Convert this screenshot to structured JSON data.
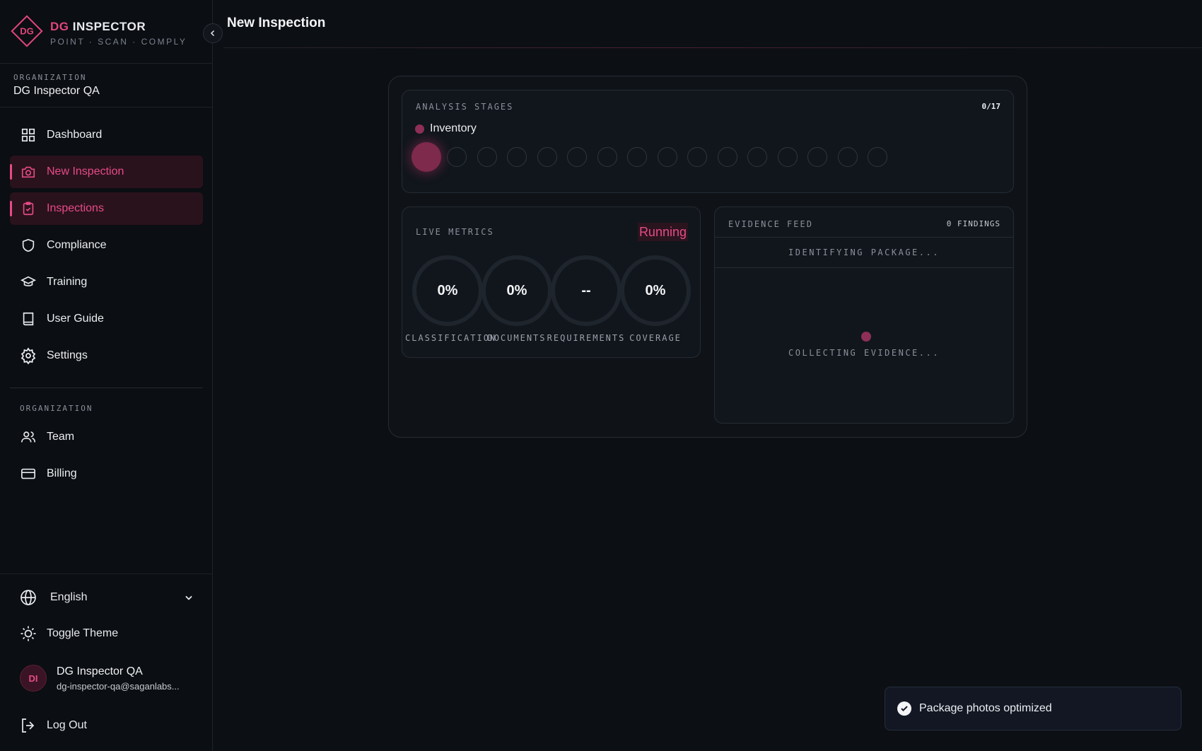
{
  "brand": {
    "name_accent": "DG",
    "name_rest": "INSPECTOR",
    "tagline": "POINT · SCAN · COMPLY",
    "logo_text": "DG",
    "accent_color": "#e0457b"
  },
  "org": {
    "label": "ORGANIZATION",
    "name": "DG Inspector QA"
  },
  "nav": [
    {
      "label": "Dashboard",
      "icon": "grid-icon",
      "active": false
    },
    {
      "label": "New Inspection",
      "icon": "camera-icon",
      "active": true
    },
    {
      "label": "Inspections",
      "icon": "clipboard-check-icon",
      "active": true
    },
    {
      "label": "Compliance",
      "icon": "shield-icon",
      "active": false
    },
    {
      "label": "Training",
      "icon": "graduation-cap-icon",
      "active": false
    },
    {
      "label": "User Guide",
      "icon": "book-icon",
      "active": false
    },
    {
      "label": "Settings",
      "icon": "gear-icon",
      "active": false
    }
  ],
  "org_section": {
    "label": "ORGANIZATION",
    "items": [
      {
        "label": "Team",
        "icon": "users-icon"
      },
      {
        "label": "Billing",
        "icon": "credit-card-icon"
      }
    ]
  },
  "footer": {
    "language": "English",
    "theme_toggle": "Toggle Theme",
    "user": {
      "initials": "DI",
      "name": "DG Inspector QA",
      "email": "dg-inspector-qa@saganlabs..."
    },
    "logout": "Log Out"
  },
  "page": {
    "title": "New Inspection"
  },
  "stages": {
    "title": "ANALYSIS STAGES",
    "count": "0/17",
    "current": "Inventory",
    "completed": 0,
    "total": 17
  },
  "metrics": {
    "title": "LIVE METRICS",
    "status": "Running",
    "gauges": [
      {
        "value": "0%",
        "label": "CLASSIFICATION",
        "fraction": 0
      },
      {
        "value": "0%",
        "label": "DOCUMENTS",
        "fraction": 0
      },
      {
        "value": "--",
        "label": "REQUIREMENTS",
        "fraction": 0
      },
      {
        "value": "0%",
        "label": "COVERAGE",
        "fraction": 0
      }
    ]
  },
  "evidence": {
    "title": "EVIDENCE FEED",
    "count": "0 FINDINGS",
    "status": "IDENTIFYING PACKAGE...",
    "empty": "COLLECTING EVIDENCE..."
  },
  "toast": {
    "message": "Package photos optimized"
  }
}
